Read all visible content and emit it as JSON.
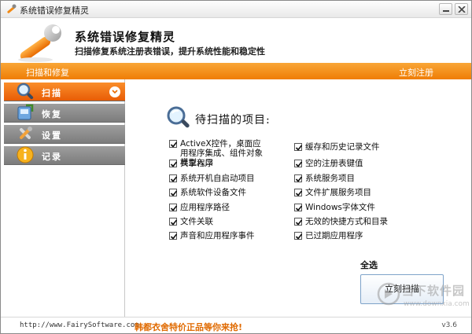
{
  "window": {
    "title": "系统错误修复精灵",
    "controls": {
      "minimize": "minimize",
      "close": "close"
    }
  },
  "header": {
    "app_name": "系统错误修复精灵",
    "subtitle": "扫描修复系统注册表错误，提升系统性能和稳定性",
    "logo_icon": "wrench-logo-icon"
  },
  "toolbar": {
    "section_label": "扫描和修复",
    "register_link": "立刻注册"
  },
  "sidebar": {
    "items": [
      {
        "label": "扫描",
        "icon": "magnifier-icon",
        "active": true
      },
      {
        "label": "恢复",
        "icon": "restore-icon",
        "active": false
      },
      {
        "label": "设置",
        "icon": "tools-icon",
        "active": false
      },
      {
        "label": "记录",
        "icon": "info-icon",
        "active": false
      }
    ]
  },
  "main": {
    "pending_title": "待扫描的项目:",
    "left_items": [
      {
        "label": "ActiveX控件，桌面应用程序集成、组件对象模型入口",
        "checked": true
      },
      {
        "label": "共享程序",
        "checked": true
      },
      {
        "label": "系统开机自启动项目",
        "checked": true
      },
      {
        "label": "系统软件设备文件",
        "checked": true
      },
      {
        "label": "应用程序路径",
        "checked": true
      },
      {
        "label": "文件关联",
        "checked": true
      },
      {
        "label": "声音和应用程序事件",
        "checked": true
      }
    ],
    "right_items": [
      {
        "label": "缓存和历史记录文件",
        "checked": true
      },
      {
        "label": "空的注册表键值",
        "checked": true
      },
      {
        "label": "系统服务项目",
        "checked": true
      },
      {
        "label": "文件扩展服务项目",
        "checked": true
      },
      {
        "label": "Windows字体文件",
        "checked": true
      },
      {
        "label": "无效的快捷方式和目录",
        "checked": true
      },
      {
        "label": "已过期应用程序",
        "checked": true
      }
    ],
    "select_all": "全选",
    "scan_button": "立刻扫描"
  },
  "footer": {
    "url": "http://www.FairySoftware.com",
    "promo": "韩都衣舍特价正品等你来抢!",
    "version": "v3.6"
  },
  "watermark": {
    "text": "当下软件园",
    "sub": "www.downxia.com"
  },
  "colors": {
    "accent_orange": "#ef7d05",
    "sidebar_gray": "#8c8c8c",
    "promo_orange": "#e06a00"
  }
}
